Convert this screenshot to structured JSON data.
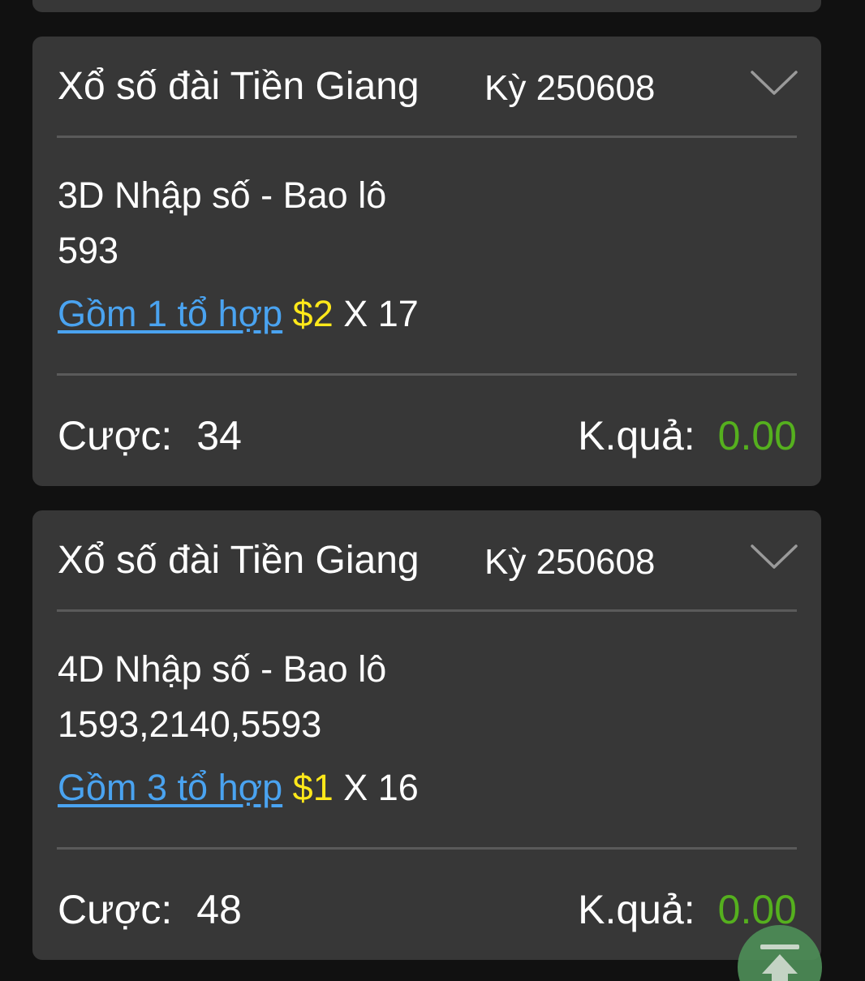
{
  "cards": [
    {
      "lottery_name": "Xổ số đài Tiền Giang",
      "period": "Kỳ 250608",
      "bet_type": "3D Nhập số - Bao lô",
      "numbers": "593",
      "combo_label": "Gồm 1 tổ hợp",
      "amount": "$2",
      "multiplier": "X 17",
      "stake_label": "Cược:",
      "stake_value": "34",
      "result_label": "K.quả:",
      "result_value": "0.00"
    },
    {
      "lottery_name": "Xổ số đài Tiền Giang",
      "period": "Kỳ 250608",
      "bet_type": "4D Nhập số - Bao lô",
      "numbers": "1593,2140,5593",
      "combo_label": "Gồm 3 tổ hợp",
      "amount": "$1",
      "multiplier": "X 16",
      "stake_label": "Cược:",
      "stake_value": "48",
      "result_label": "K.quả:",
      "result_value": "0.00"
    }
  ],
  "icons": {
    "expand": "chevron-down-icon",
    "scroll_top": "scroll-to-top-icon"
  },
  "colors": {
    "background": "#111111",
    "card": "#373737",
    "link": "#4aa3f0",
    "amount": "#ffe81a",
    "result": "#55b01e"
  }
}
